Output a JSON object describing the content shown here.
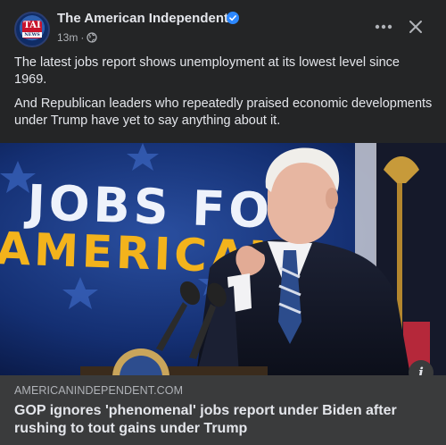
{
  "post": {
    "page_name": "The American Independent",
    "time": "13m",
    "separator": "·",
    "avatar_text": "TAI",
    "avatar_sub": "NEWS",
    "paragraphs": [
      "The latest jobs report shows unemployment at its lowest level since 1969.",
      "And Republican leaders who repeatedly praised economic developments under Trump have yet to say anything about it."
    ]
  },
  "image": {
    "sign_line1": "JOBS FOR",
    "sign_line2": "AMERICAN"
  },
  "link": {
    "domain": "AMERICANINDEPENDENT.COM",
    "title": "GOP ignores 'phenomenal' jobs report under Biden after rushing to tout gains under Trump",
    "info_label": "i"
  },
  "colors": {
    "background": "#242526",
    "link_box": "#3a3b3c",
    "text_primary": "#e4e6eb",
    "text_secondary": "#b0b3b8",
    "verified": "#2d88ff"
  },
  "icons": [
    "verified-badge-icon",
    "globe-icon",
    "more-icon",
    "close-icon",
    "info-icon"
  ]
}
